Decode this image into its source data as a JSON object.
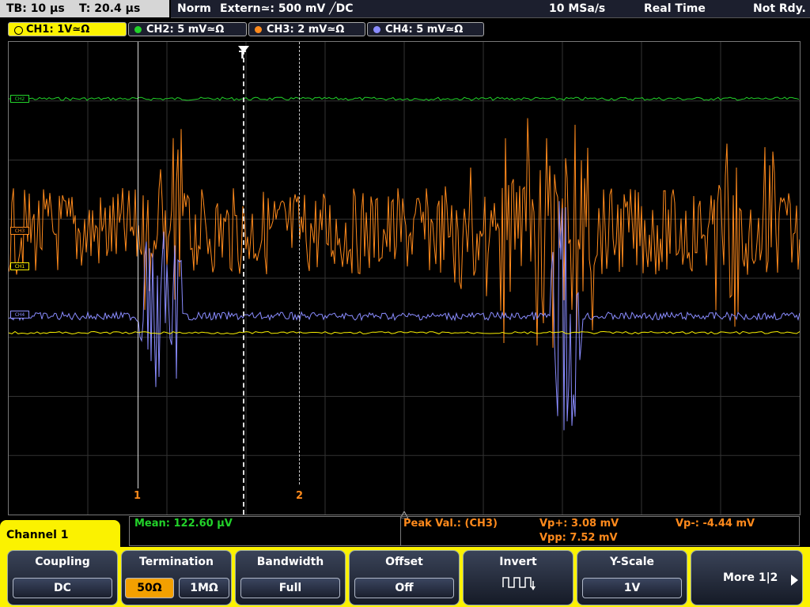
{
  "topbar": {
    "timebase": "TB: 10 µs",
    "trigger_time": "T: 20.4 µs",
    "trigger_mode": "Norm",
    "trigger_source": "Extern≃: 500 mV ╱DC",
    "sample_rate": "10 MSa/s",
    "acq_mode": "Real Time",
    "status": "Not Rdy."
  },
  "channels": [
    {
      "label": "CH1: 1V≃Ω",
      "color": "#fbf200",
      "active": true
    },
    {
      "label": "CH2: 5 mV≃Ω",
      "color": "#22d22a",
      "active": false
    },
    {
      "label": "CH3: 2 mV≃Ω",
      "color": "#ff8a1c",
      "active": false
    },
    {
      "label": "CH4: 5 mV≃Ω",
      "color": "#8a8cff",
      "active": false
    }
  ],
  "screen": {
    "cursor1_label": "1",
    "cursor2_label": "2",
    "trigger_label": "T",
    "edge_markers": [
      "CH2",
      "CH3",
      "CH1",
      "CH4"
    ]
  },
  "measurements": {
    "mean": "Mean: 122.60 µV",
    "peak_title": "Peak Val.:  (CH3)",
    "vp_plus": "Vp+: 3.08 mV",
    "vpp": "Vpp: 7.52 mV",
    "vp_minus": "Vp-: -4.44 mV",
    "mean_color": "#22d22a",
    "peak_color": "#ff8a1c"
  },
  "menu": {
    "channel_title": "Channel 1",
    "coupling_title": "Coupling",
    "coupling_value": "DC",
    "termination_title": "Termination",
    "termination_50": "50Ω",
    "termination_1m": "1MΩ",
    "bandwidth_title": "Bandwidth",
    "bandwidth_value": "Full",
    "offset_title": "Offset",
    "offset_value": "Off",
    "invert_title": "Invert",
    "yscale_title": "Y-Scale",
    "yscale_value": "1V",
    "more_label": "More 1|2",
    "more_icon": "arrow-right-icon",
    "invert_icon": "square-wave-icon"
  }
}
